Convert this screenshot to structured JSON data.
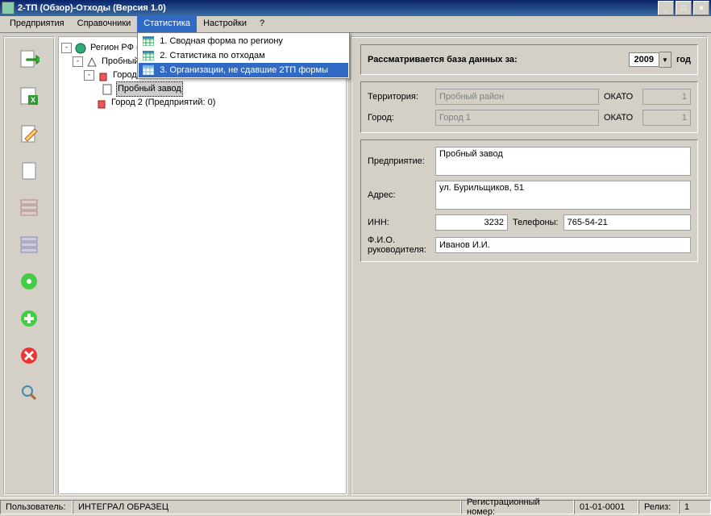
{
  "titlebar": {
    "title": "2-ТП (Обзор)-Отходы (Версия 1.0)"
  },
  "menu": {
    "items": [
      "Предприятия",
      "Справочники",
      "Статистика",
      "Настройки",
      "?"
    ],
    "open_index": 2,
    "dropdown": [
      {
        "label": "1. Сводная форма по региону"
      },
      {
        "label": "2. Статистика по отходам"
      },
      {
        "label": "3. Организации, не сдавшие 2ТП формы",
        "hl": true
      }
    ]
  },
  "tree": {
    "root": "Регион РФ (",
    "district": "Пробный",
    "city1": "Город",
    "plant": "Пробный завод",
    "city2": "Город 2 (Предприятий: 0)"
  },
  "form": {
    "header": "Рассматривается база данных за:",
    "year": "2009",
    "year_suffix": "год",
    "territory_lbl": "Территория:",
    "territory": "Пробный район",
    "city_lbl": "Город:",
    "city": "Город 1",
    "okato_lbl": "ОКАТО",
    "okato1": "1",
    "okato2": "1",
    "enterprise_lbl": "Предприятие:",
    "enterprise": "Пробный завод",
    "address_lbl": "Адрес:",
    "address": "ул. Бурильщиков, 51",
    "inn_lbl": "ИНН:",
    "inn": "3232",
    "phone_lbl": "Телефоны:",
    "phone": "765-54-21",
    "fio_lbl1": "Ф.И.О.",
    "fio_lbl2": "руководителя:",
    "fio": "Иванов И.И."
  },
  "status": {
    "user_lbl": "Пользователь:",
    "user": "ИНТЕГРАЛ ОБРАЗЕЦ",
    "reg_lbl": "Регистрационный номер:",
    "reg": "01-01-0001",
    "rel_lbl": "Релиз:",
    "rel": "1"
  },
  "icons": {
    "export": "export-icon",
    "excel": "excel-icon",
    "edit": "edit-icon",
    "new": "new-icon",
    "list1": "list-icon",
    "list2": "list2-icon",
    "ok": "ok-icon",
    "add": "add-icon",
    "del": "delete-icon",
    "search": "search-icon"
  }
}
